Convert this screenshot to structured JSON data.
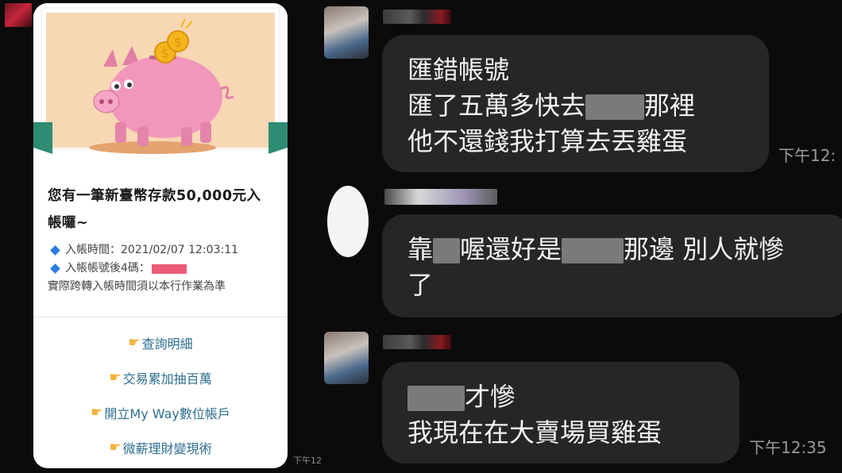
{
  "card": {
    "title": "您有一筆新臺幣存款50,000元入帳囉~",
    "deposit_time": "入帳時間：2021/02/07 12:03:11",
    "account_last4": "入帳帳號後4碼：",
    "note": "實際跨轉入帳時間須以本行作業為準",
    "links": [
      {
        "label": "查詢明細",
        "icon": "pointing-hand-icon"
      },
      {
        "label": "交易累加抽百萬",
        "icon": "pointing-hand-icon"
      },
      {
        "label": "開立My Way數位帳戶",
        "icon": "pointing-hand-icon"
      },
      {
        "label": "微薪理財變現術",
        "icon": "pointing-hand-icon"
      }
    ],
    "time": "下午12"
  },
  "messages": [
    {
      "lines": [
        "匯錯帳號",
        "匯了五萬多快去",
        "那裡",
        "他不還錢我打算去丟雞蛋"
      ],
      "time": "下午12:"
    },
    {
      "lines": [
        "靠",
        "喔還好是",
        "那邊 別人就慘",
        "了"
      ]
    },
    {
      "lines": [
        "才慘",
        "我現在在大賣場買雞蛋"
      ],
      "time": "下午12:35"
    }
  ],
  "colors": {
    "background": "#0b0b0b",
    "bubble": "#262626",
    "card": "#ffffff",
    "link": "#2f6f8f",
    "accent_blue": "#2a7de1"
  }
}
